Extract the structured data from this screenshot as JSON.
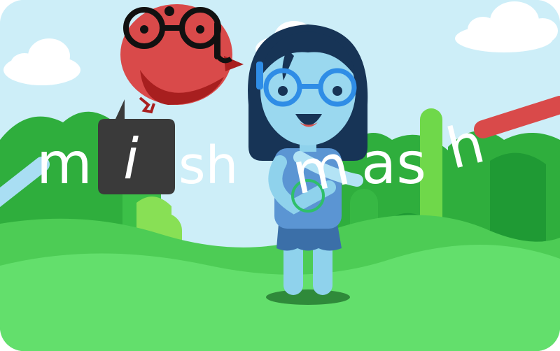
{
  "logo": {
    "text": "mishmash",
    "letters": [
      "m",
      "i",
      "sh",
      "m",
      "as",
      "h"
    ]
  },
  "colors": {
    "sky": "#cdeef8",
    "hill_back": "#2fae3d",
    "hill_front": "#5fe06a",
    "bird": "#d94a4a",
    "girl_skin": "#8fd2ec",
    "girl_hair": "#173456",
    "glasses": "#2f8de6"
  },
  "icons": [
    "bird-icon",
    "girl-icon",
    "speech-bubble-icon",
    "cloud-icon",
    "bush-icon"
  ]
}
